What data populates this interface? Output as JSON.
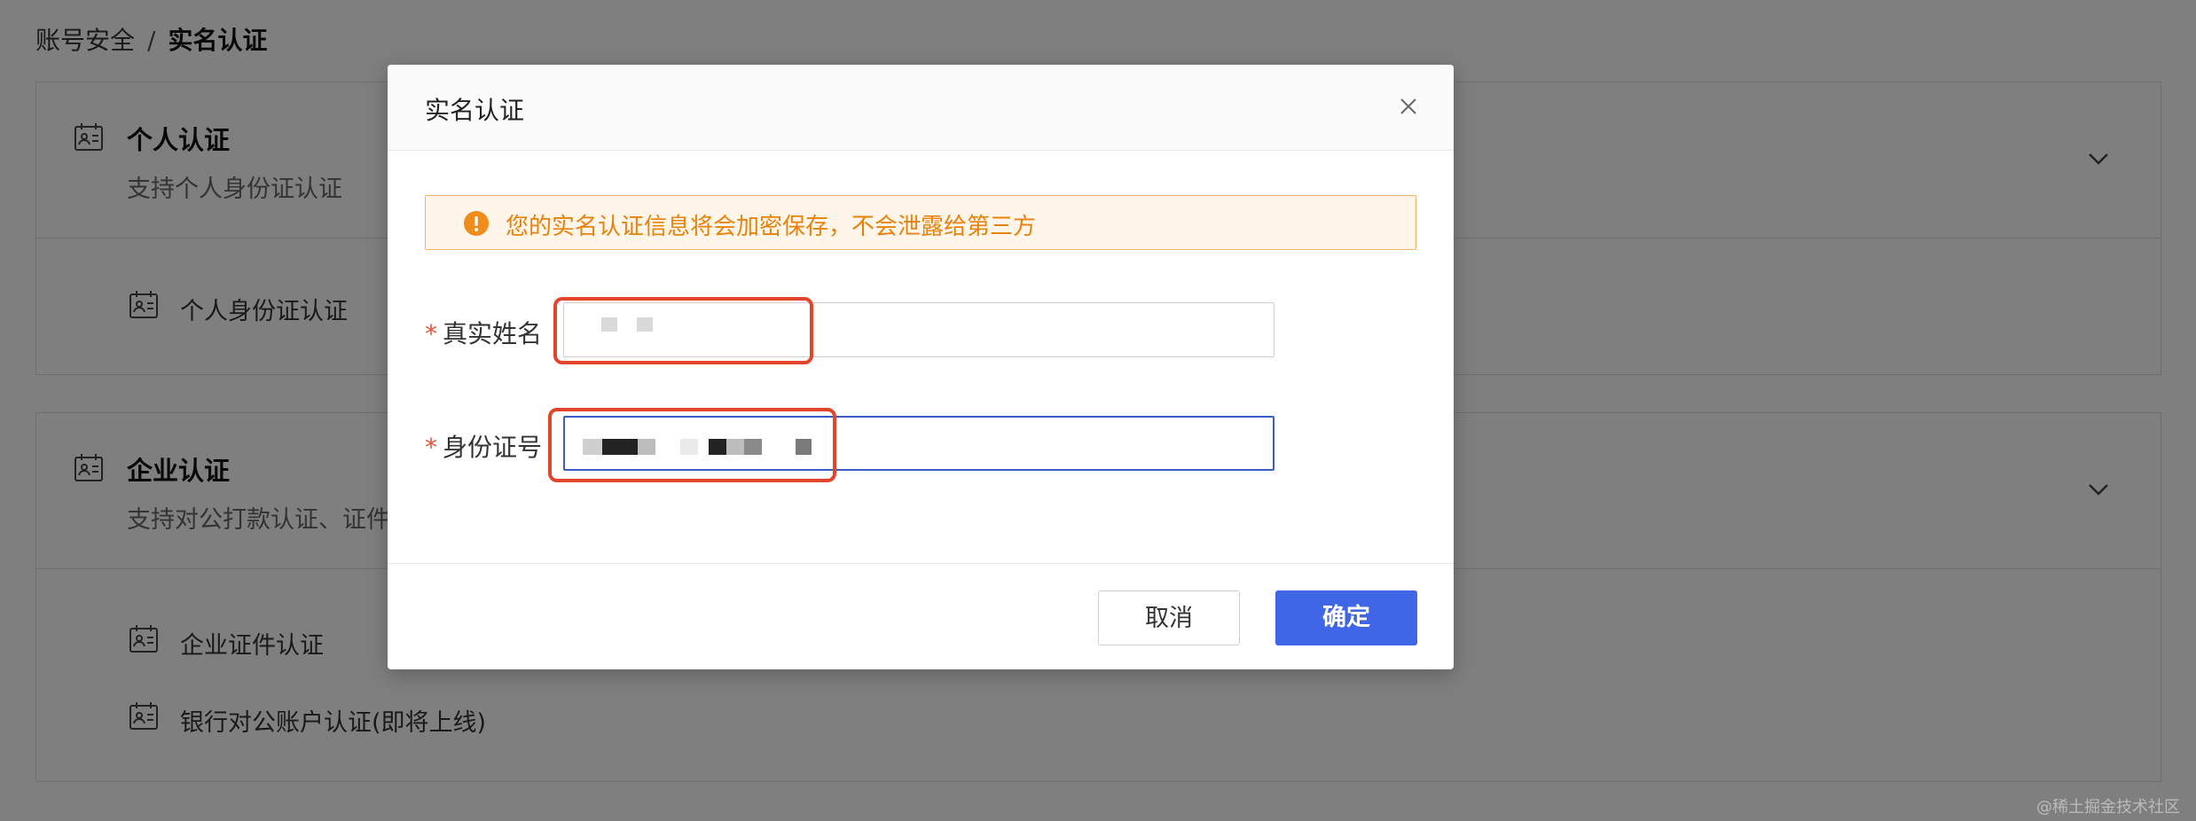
{
  "breadcrumb": {
    "parent": "账号安全",
    "separator": "/",
    "current": "实名认证"
  },
  "personal": {
    "title": "个人认证",
    "desc": "支持个人身份证认证",
    "items": [
      {
        "label": "个人身份证认证"
      }
    ]
  },
  "enterprise": {
    "title": "企业认证",
    "desc": "支持对公打款认证、证件",
    "items": [
      {
        "label": "企业证件认证"
      },
      {
        "label": "银行对公账户认证(即将上线)"
      }
    ]
  },
  "dialog": {
    "title": "实名认证",
    "alert": "您的实名认证信息将会加密保存，不会泄露给第三方",
    "fields": [
      {
        "label": "真实姓名",
        "required_mark": "*",
        "value": ""
      },
      {
        "label": "身份证号",
        "required_mark": "*",
        "value": ""
      }
    ],
    "cancel_label": "取消",
    "ok_label": "确定"
  },
  "watermark": "@稀土掘金技术社区",
  "colors": {
    "accent": "#3f66e6",
    "warning": "#e8820c",
    "highlight": "#e2452b"
  }
}
